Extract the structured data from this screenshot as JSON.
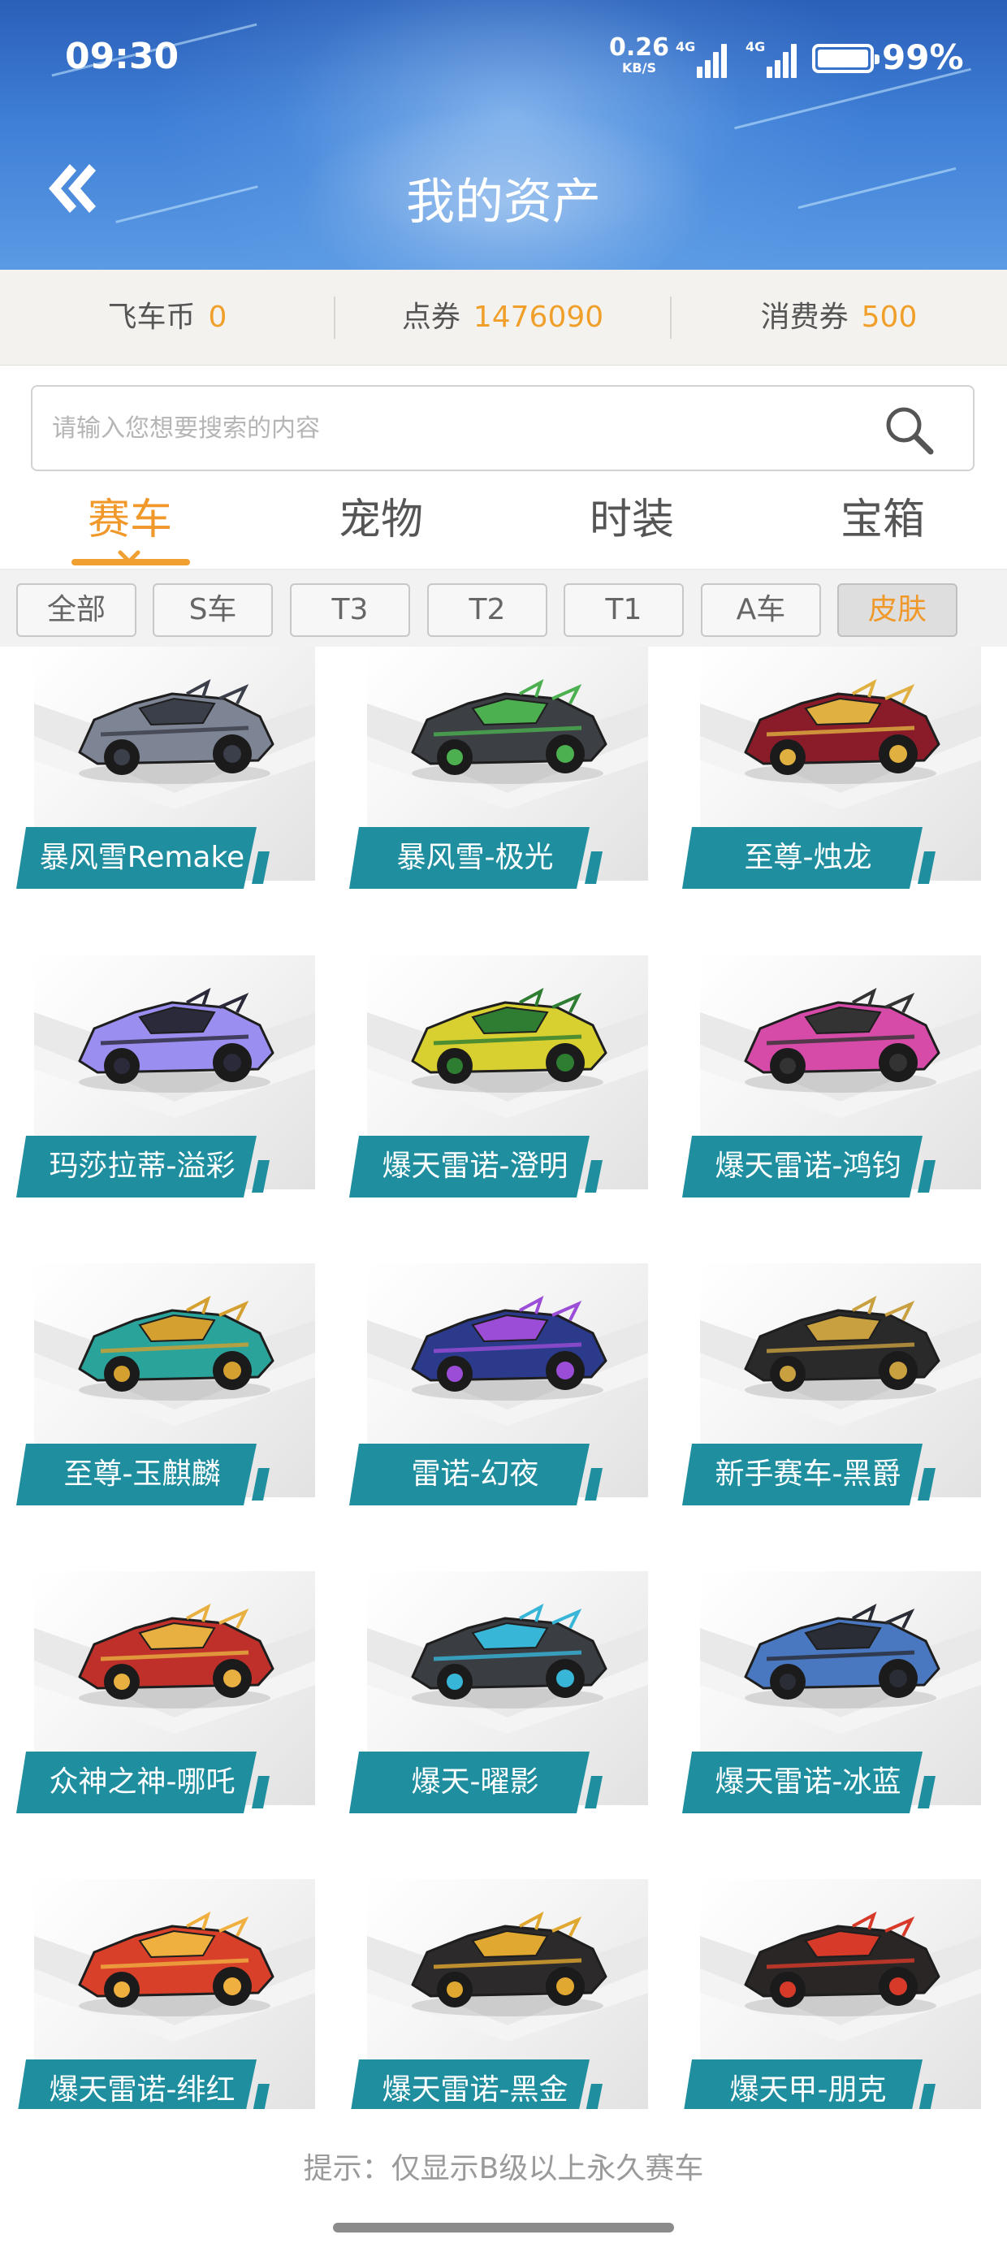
{
  "status_bar": {
    "time": "09:30",
    "net_speed": "0.26",
    "net_unit": "KB/S",
    "signal1": "4G",
    "signal2": "4G",
    "battery": "99%"
  },
  "header": {
    "title": "我的资产",
    "back_icon": "double-chevron-left-icon"
  },
  "currency": [
    {
      "label": "飞车币",
      "value": "0"
    },
    {
      "label": "点券",
      "value": "1476090"
    },
    {
      "label": "消费券",
      "value": "500"
    }
  ],
  "search": {
    "placeholder": "请输入您想要搜索的内容",
    "icon": "search-icon"
  },
  "tabs": [
    {
      "label": "赛车",
      "active": true
    },
    {
      "label": "宠物",
      "active": false
    },
    {
      "label": "时装",
      "active": false
    },
    {
      "label": "宝箱",
      "active": false
    }
  ],
  "filters": [
    {
      "label": "全部",
      "active": false
    },
    {
      "label": "S车",
      "active": false
    },
    {
      "label": "T3",
      "active": false
    },
    {
      "label": "T2",
      "active": false
    },
    {
      "label": "T1",
      "active": false
    },
    {
      "label": "A车",
      "active": false
    },
    {
      "label": "皮肤",
      "active": true
    }
  ],
  "cars": [
    {
      "name": "暴风雪Remake",
      "color": "#7d8494",
      "accent": "#3a3f4a"
    },
    {
      "name": "暴风雪-极光",
      "color": "#3c3f44",
      "accent": "#4caf50"
    },
    {
      "name": "至尊-烛龙",
      "color": "#8a1c2a",
      "accent": "#e0b040"
    },
    {
      "name": "玛莎拉蒂-溢彩",
      "color": "#9a8ef0",
      "accent": "#2a2a3a"
    },
    {
      "name": "爆天雷诺-澄明",
      "color": "#d8d030",
      "accent": "#2e7d32"
    },
    {
      "name": "爆天雷诺-鸿钧",
      "color": "#d64aa8",
      "accent": "#333333"
    },
    {
      "name": "至尊-玉麒麟",
      "color": "#2aa39a",
      "accent": "#d4a030"
    },
    {
      "name": "雷诺-幻夜",
      "color": "#2b3a8a",
      "accent": "#9c4dd8"
    },
    {
      "name": "新手赛车-黑爵",
      "color": "#2a2a2a",
      "accent": "#c9a040"
    },
    {
      "name": "众神之神-哪吒",
      "color": "#c0302a",
      "accent": "#e8b040"
    },
    {
      "name": "爆天-曜影",
      "color": "#3a3d42",
      "accent": "#38b6d8"
    },
    {
      "name": "爆天雷诺-冰蓝",
      "color": "#4a78c0",
      "accent": "#2a2d36"
    },
    {
      "name": "爆天雷诺-绯红",
      "color": "#d8402a",
      "accent": "#f0b040"
    },
    {
      "name": "爆天雷诺-黑金",
      "color": "#2c2a2a",
      "accent": "#e0a830"
    },
    {
      "name": "爆天甲-朋克",
      "color": "#2a2626",
      "accent": "#d83a2a"
    }
  ],
  "footer_hint": "提示：仅显示B级以上永久赛车",
  "colors": {
    "accent": "#f0992a",
    "label_teal": "#1f8fa0",
    "header_blue": "#3f7fd6"
  }
}
